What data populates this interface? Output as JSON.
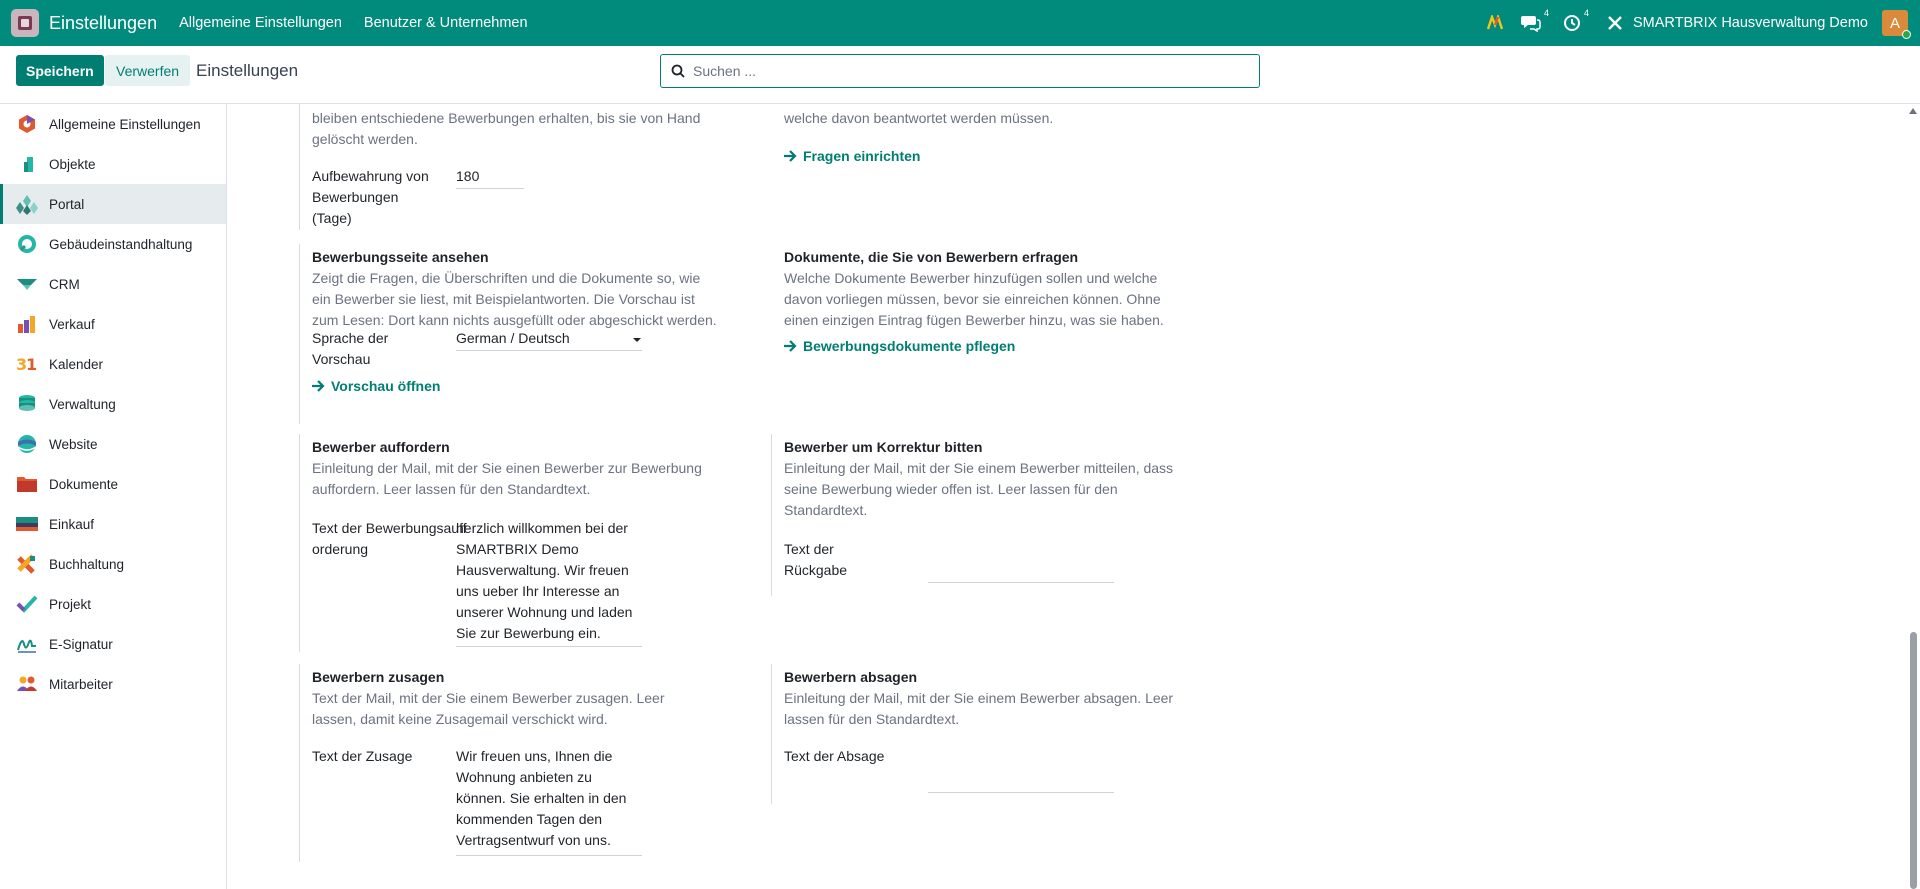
{
  "navbar": {
    "app_title": "Einstellungen",
    "menu": [
      "Allgemeine Einstellungen",
      "Benutzer & Unternehmen"
    ],
    "messages_count": "4",
    "activities_count": "4",
    "company": "SMARTBRIX Hausverwaltung Demo",
    "avatar_letter": "A"
  },
  "control": {
    "save": "Speichern",
    "discard": "Verwerfen",
    "title": "Einstellungen",
    "search_placeholder": "Suchen ..."
  },
  "sidebar": {
    "items": [
      {
        "label": "Allgemeine Einstellungen",
        "icon": "settings-icon"
      },
      {
        "label": "Objekte",
        "icon": "building-icon"
      },
      {
        "label": "Portal",
        "icon": "portal-icon",
        "active": true
      },
      {
        "label": "Gebäudeinstandhaltung",
        "icon": "maintenance-icon"
      },
      {
        "label": "CRM",
        "icon": "crm-icon"
      },
      {
        "label": "Verkauf",
        "icon": "sales-icon"
      },
      {
        "label": "Kalender",
        "icon": "calendar-icon"
      },
      {
        "label": "Verwaltung",
        "icon": "management-icon"
      },
      {
        "label": "Website",
        "icon": "website-icon"
      },
      {
        "label": "Dokumente",
        "icon": "documents-icon"
      },
      {
        "label": "Einkauf",
        "icon": "purchase-icon"
      },
      {
        "label": "Buchhaltung",
        "icon": "accounting-icon"
      },
      {
        "label": "Projekt",
        "icon": "project-icon"
      },
      {
        "label": "E-Signatur",
        "icon": "signature-icon"
      },
      {
        "label": "Mitarbeiter",
        "icon": "employees-icon"
      }
    ]
  },
  "settings": {
    "retention": {
      "desc_line1": "bleiben entschiedene Bewerbungen erhalten, bis sie von Hand",
      "desc_line2": "gelöscht werden.",
      "field_label": "Aufbewahrung von Bewerbungen (Tage)",
      "field_value": "180"
    },
    "questions": {
      "desc_line": "welche davon beantwortet werden müssen.",
      "link": "Fragen einrichten"
    },
    "preview": {
      "title": "Bewerbungsseite ansehen",
      "desc": "Zeigt die Fragen, die Überschriften und die Dokumente so, wie ein Bewerber sie liest, mit Beispielantworten. Die Vorschau ist zum Lesen: Dort kann nichts ausgefüllt oder abgeschickt werden.",
      "field_label": "Sprache der Vorschau",
      "field_value": "German / Deutsch",
      "link": "Vorschau öffnen"
    },
    "documents": {
      "title": "Dokumente, die Sie von Bewerbern erfragen",
      "desc": "Welche Dokumente Bewerber hinzufügen sollen und welche davon vorliegen müssen, bevor sie einreichen können. Ohne einen einzigen Eintrag fügen Bewerber hinzu, was sie haben.",
      "link": "Bewerbungsdokumente pflegen"
    },
    "invite": {
      "title": "Bewerber auffordern",
      "desc": "Einleitung der Mail, mit der Sie einen Bewerber zur Bewerbung auffordern. Leer lassen für den Standardtext.",
      "field_label": "Text der Bewerbungsaufforderung",
      "field_value": "herzlich willkommen bei der SMARTBRIX Demo Hausverwaltung. Wir freuen uns ueber Ihr Interesse an unserer Wohnung und laden Sie zur Bewerbung ein."
    },
    "correction": {
      "title": "Bewerber um Korrektur bitten",
      "desc": "Einleitung der Mail, mit der Sie einem Bewerber mitteilen, dass seine Bewerbung wieder offen ist. Leer lassen für den Standardtext.",
      "field_label": "Text der Rückgabe",
      "field_value": ""
    },
    "accept": {
      "title": "Bewerbern zusagen",
      "desc": "Text der Mail, mit der Sie einem Bewerber zusagen. Leer lassen, damit keine Zusagemail verschickt wird.",
      "field_label": "Text der Zusage",
      "field_value": "Wir freuen uns, Ihnen die Wohnung anbieten zu können. Sie erhalten in den kommenden Tagen den Vertragsentwurf von uns."
    },
    "reject": {
      "title": "Bewerbern absagen",
      "desc": "Einleitung der Mail, mit der Sie einem Bewerber absagen. Leer lassen für den Standardtext.",
      "field_label": "Text der Absage",
      "field_value": ""
    }
  },
  "colors": {
    "brand": "#018b7d",
    "primary": "#017e72"
  }
}
